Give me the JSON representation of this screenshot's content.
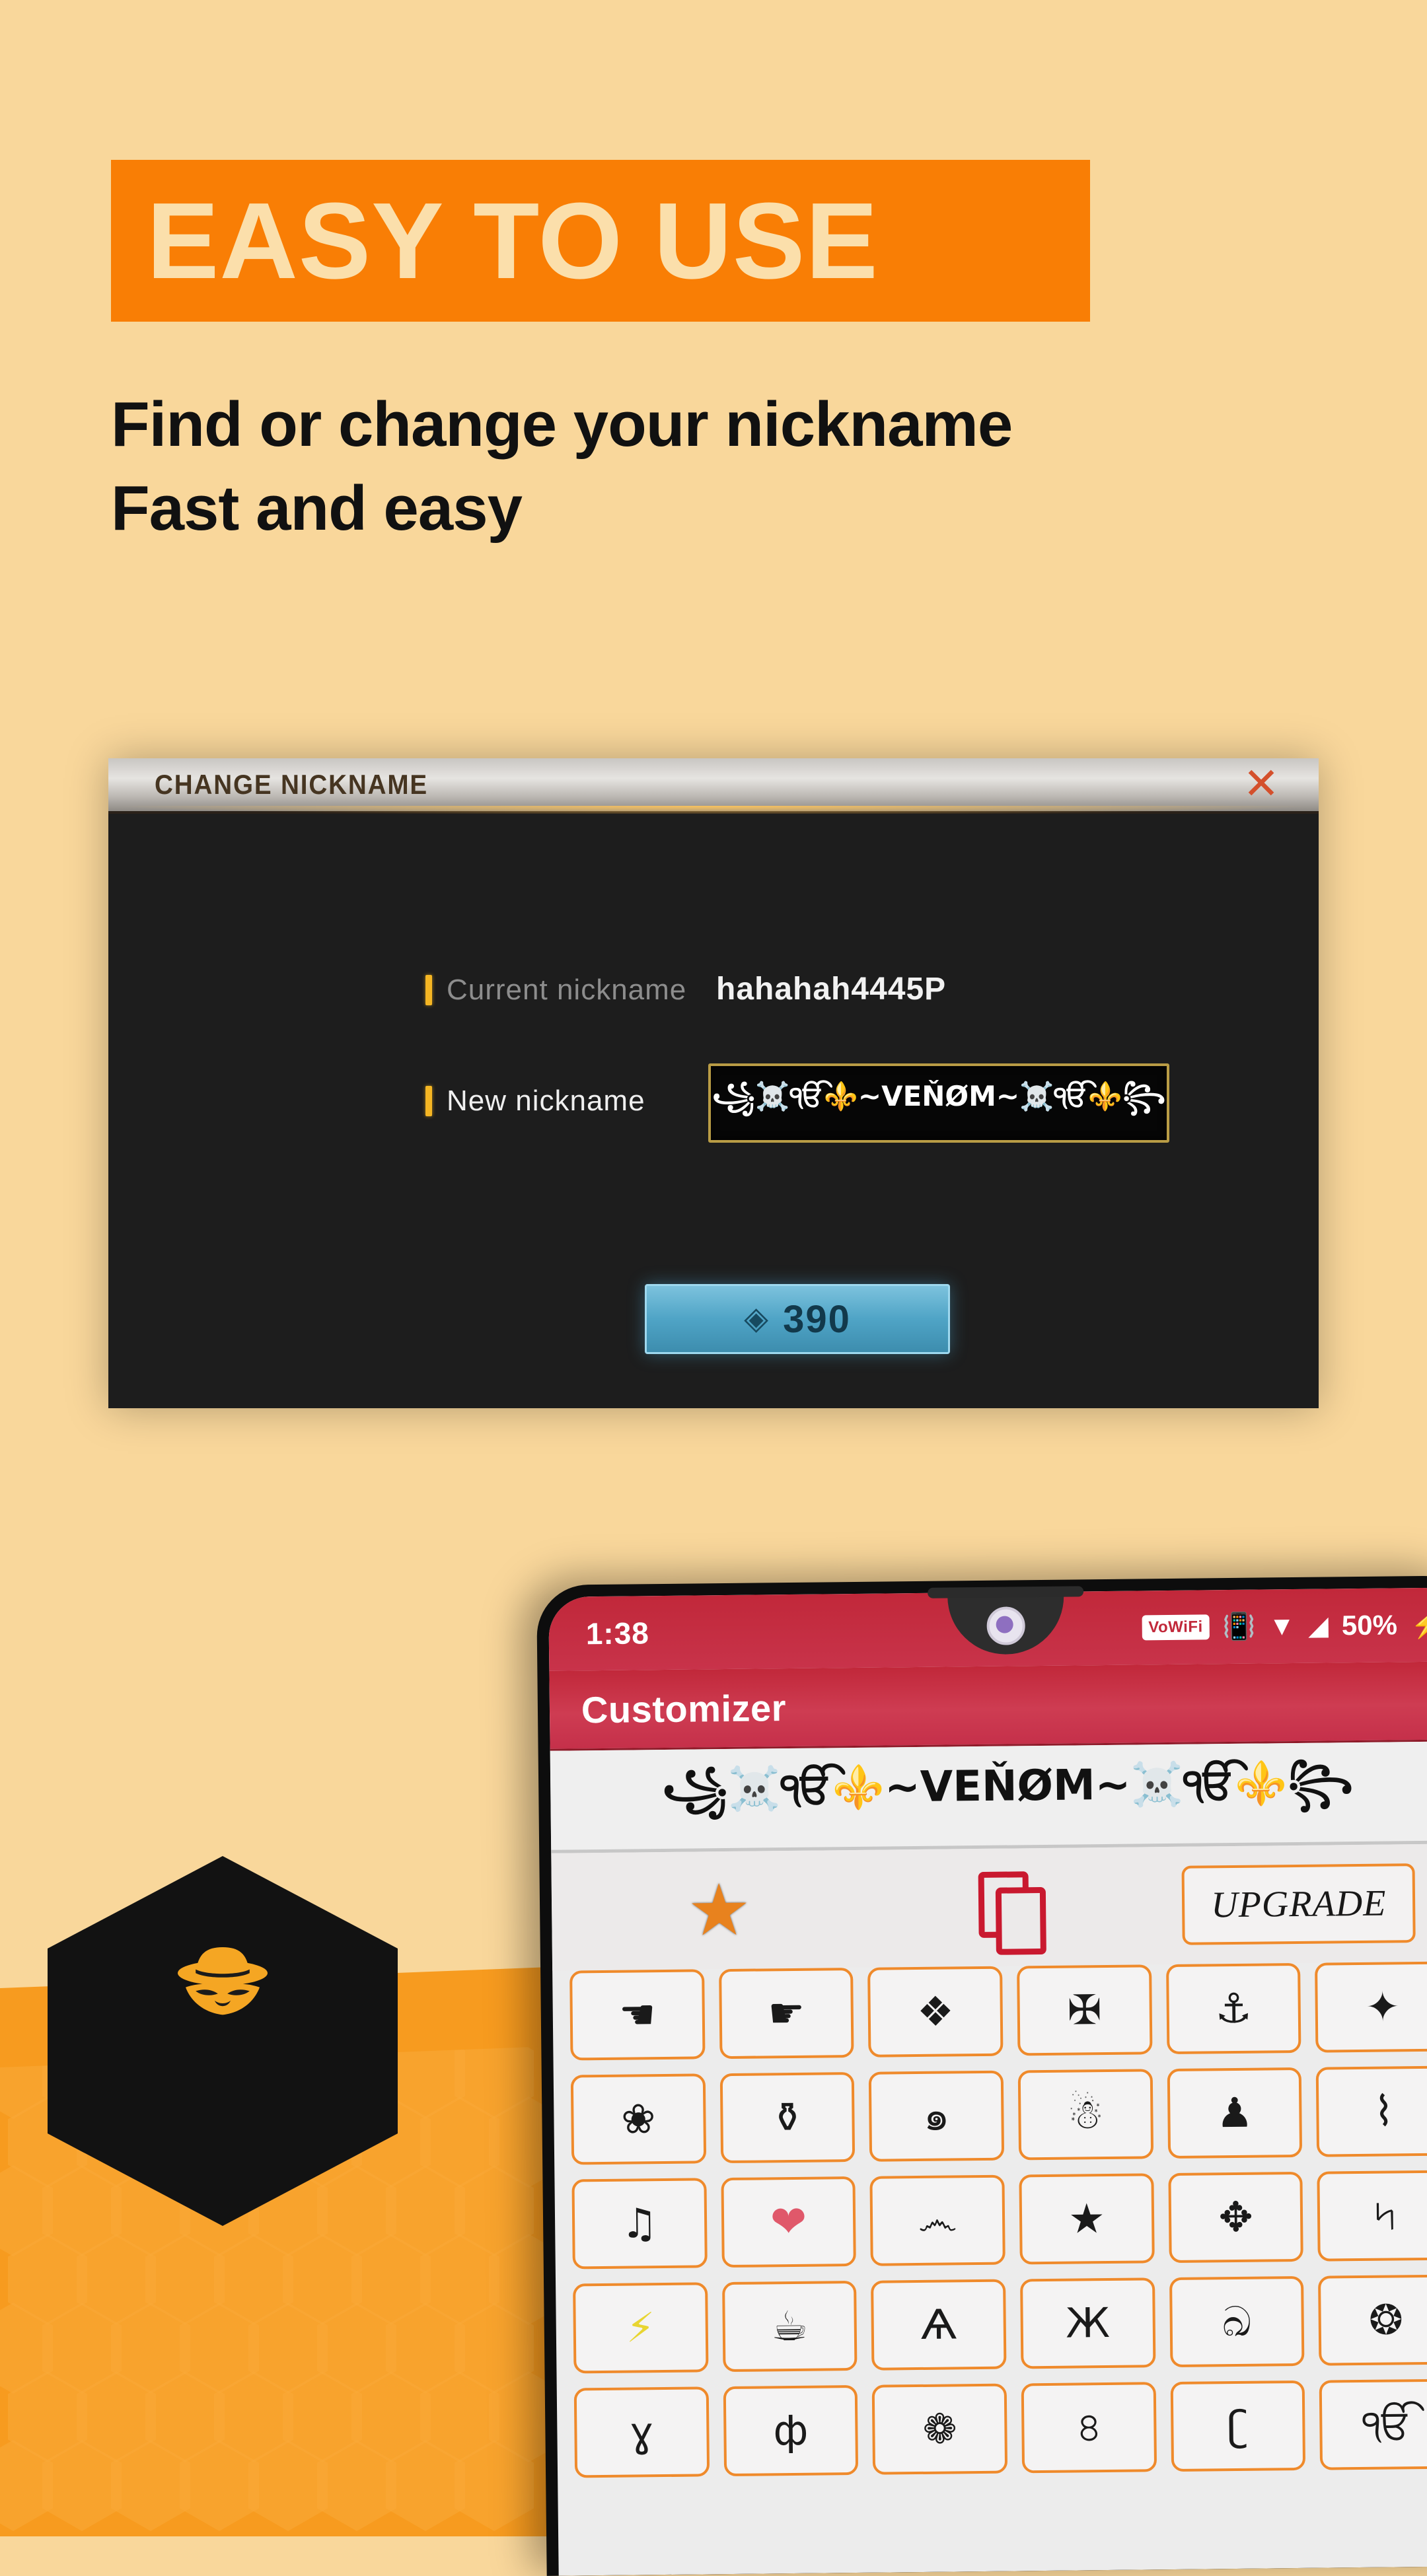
{
  "promo": {
    "headline": "EASY TO USE",
    "subtitle_line1": "Find or change your nickname",
    "subtitle_line2": "Fast and easy",
    "band_color": "#f97e05",
    "page_bg": "#f9d79b",
    "accent_orange": "#f79b1f"
  },
  "game_dialog": {
    "title": "CHANGE NICKNAME",
    "close_icon": "✕",
    "current_label": "Current nickname",
    "current_value": "hahahah4445P",
    "new_label": "New nickname",
    "new_value": "꧁☠️ੴ⚜️~VEŇØM~☠️ੴ⚜️꧂",
    "price_icon": "gem-icon",
    "price_value": "390"
  },
  "phone": {
    "statusbar": {
      "time": "1:38",
      "vowifi_badge": "VoWiFi",
      "vibrate_icon": "vibrate-icon",
      "wifi_icon": "wifi-icon",
      "signal_icon": "signal-icon",
      "battery_percent": "50%",
      "charging_icon": "charging-bolt-icon"
    },
    "appbar": {
      "title": "Customizer"
    },
    "preview": {
      "nickname": "꧁☠️ੴ⚜️~VEŇØM~☠️ੴ⚜️꧂"
    },
    "toolbar": {
      "favorite_icon": "star-icon",
      "copy_icon": "copy-icon",
      "upgrade_label": "UPGRADE"
    },
    "symbol_grid": {
      "rows": [
        [
          "☚",
          "☛",
          "❖",
          "✠",
          "⚓",
          "✦"
        ],
        [
          "❀",
          "⚱",
          "๑",
          "☃",
          "♟",
          "⌇"
        ],
        [
          "♫",
          "❤",
          "෴",
          "★",
          "✥",
          "৸"
        ],
        [
          "⚡",
          "☕",
          "Ѧ",
          "Ж",
          "ඛ",
          "❂"
        ],
        [
          "ɣ",
          "ф",
          "❁",
          "৪",
          "ʗ",
          "ੴ"
        ]
      ]
    }
  }
}
